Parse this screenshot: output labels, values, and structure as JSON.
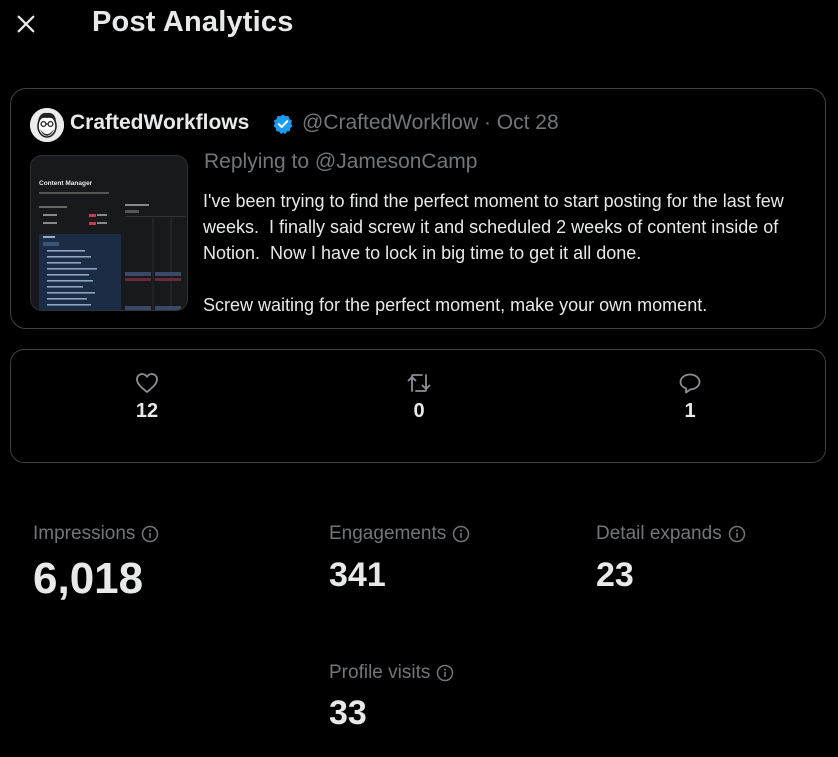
{
  "header": {
    "title": "Post Analytics",
    "close_icon": "close-icon"
  },
  "post": {
    "author_name": "CraftedWorkflows",
    "verified": true,
    "handle_date": "@CraftedWorkflow · Oct 28",
    "replying_prefix": "Replying to ",
    "replying_to": "@JamesonCamp",
    "body": "I've been trying to find the perfect moment to start posting for the last few weeks.  I finally said screw it and scheduled 2 weeks of content inside of Notion.  Now I have to lock in big time to get it all done.\n\nScrew waiting for the perfect moment, make your own moment.",
    "thumbnail": {
      "title": "Content Manager"
    }
  },
  "engagement": {
    "likes": "12",
    "reposts": "0",
    "replies": "1"
  },
  "metrics": {
    "impressions_label": "Impressions",
    "impressions_value": "6,018",
    "engagements_label": "Engagements",
    "engagements_value": "341",
    "detail_label": "Detail expands",
    "detail_value": "23",
    "profile_label": "Profile visits",
    "profile_value": "33"
  },
  "colors": {
    "background": "#000000",
    "text": "#e7e9ea",
    "muted": "#71767b",
    "border": "#3d4247",
    "verified": "#1d9bf0"
  }
}
